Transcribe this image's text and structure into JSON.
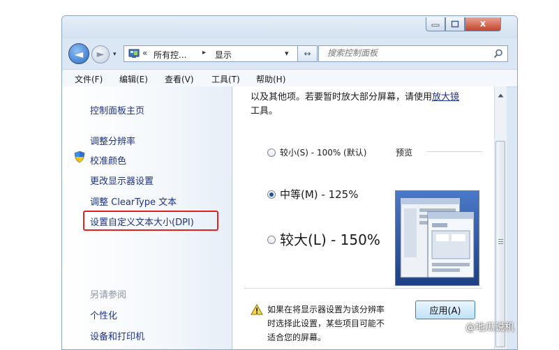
{
  "window": {
    "close_glyph": "x"
  },
  "nav": {
    "back_glyph": "◄",
    "fwd_glyph": "►",
    "history_glyph": "▾",
    "breadcrumb_overflow": "«",
    "breadcrumb_parent": "所有控...",
    "breadcrumb_sep": "▸",
    "breadcrumb_current": "显示",
    "address_dropdown": "▾",
    "refresh_glyph": "↔",
    "search_placeholder": "搜索控制面板"
  },
  "menu": {
    "file": "文件(F)",
    "edit": "编辑(E)",
    "view": "查看(V)",
    "tools": "工具(T)",
    "help": "帮助(H)"
  },
  "sidebar": {
    "home": "控制面板主页",
    "items": [
      "调整分辨率",
      "校准颜色",
      "更改显示器设置",
      "调整 ClearType 文本",
      "设置自定义文本大小(DPI)"
    ],
    "see_also": "另请参阅",
    "see_also_items": [
      "个性化",
      "设备和打印机"
    ]
  },
  "content": {
    "intro_line1": "以及其他项。若要暂时放大部分屏幕，请使用",
    "intro_link": "放大镜",
    "intro_line2": "工具。",
    "options": [
      {
        "label": "较小(S) - 100% (默认)",
        "selected": false
      },
      {
        "label": "中等(M) - 125%",
        "selected": true
      },
      {
        "label": "较大(L) - 150%",
        "selected": false
      }
    ],
    "preview_label": "预览",
    "warning_lines": [
      "如果在将显示器设置为该分辨率",
      "时选择此设置，某些项目可能不",
      "适合您的屏幕。"
    ],
    "apply_label": "应用(A)"
  },
  "watermark": "@地瓜说机",
  "colors": {
    "highlight": "#e0201e",
    "link": "#1e3287"
  }
}
